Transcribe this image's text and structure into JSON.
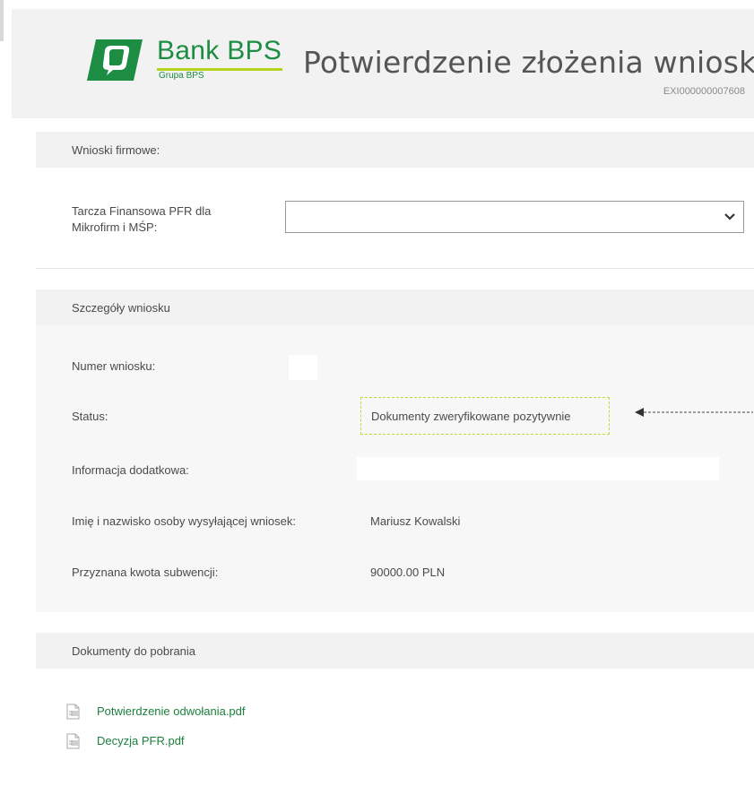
{
  "header": {
    "brand_name": "Bank BPS",
    "brand_subtitle": "Grupa BPS",
    "title": "Potwierdzenie złożenia wniosku",
    "application_id": "EXI000000007608"
  },
  "company_section": {
    "heading": "Wnioski firmowe:",
    "field_label_line1": "Tarcza Finansowa PFR dla",
    "field_label_line2": "Mikrofirm i MŚP:",
    "select_value": ""
  },
  "details_section": {
    "heading": "Szczegóły wniosku",
    "rows": [
      {
        "label": "Numer wniosku:",
        "value": ""
      },
      {
        "label": "Status:",
        "value": "Dokumenty zweryfikowane pozytywnie"
      },
      {
        "label": "Informacja dodatkowa:",
        "value": ""
      },
      {
        "label": "Imię i nazwisko osoby wysyłającej wniosek:",
        "value": "Mariusz Kowalski"
      },
      {
        "label": "Przyznana kwota subwencji:",
        "value": "90000.00 PLN"
      }
    ]
  },
  "documents_section": {
    "heading": "Dokumenty do pobrania",
    "files": [
      {
        "name": "Potwierdzenie odwołania.pdf",
        "icon": "pdf-file-icon"
      },
      {
        "name": "Decyzja PFR.pdf",
        "icon": "pdf-file-icon"
      }
    ]
  },
  "colors": {
    "brand_green": "#1c8d43",
    "accent_lime": "#b6d31b",
    "link_green": "#1c7f3c",
    "status_highlight": "#c6d53a"
  }
}
